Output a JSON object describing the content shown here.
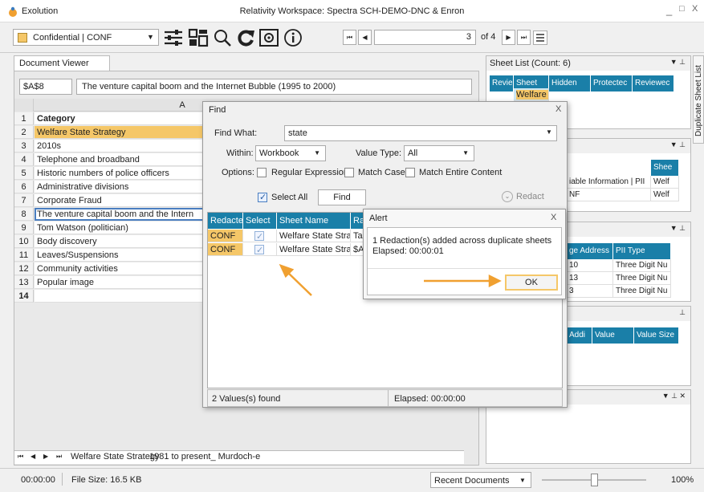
{
  "titlebar": {
    "app_name": "Exolution",
    "window_title": "Relativity Workspace: Spectra SCH-DEMO-DNC & Enron",
    "min": "_",
    "max": "□",
    "close": "X"
  },
  "toolbar": {
    "classification": "Confidential | CONF",
    "page_value": "3",
    "page_of": "of 4"
  },
  "doc_viewer": {
    "tab_label": "Document Viewer",
    "cell_ref": "$A$8",
    "formula": "The venture capital boom and the Internet Bubble (1995 to 2000)",
    "column_header": "A",
    "rows": [
      {
        "num": "1",
        "text": "Category"
      },
      {
        "num": "2",
        "text": "Welfare State Strategy"
      },
      {
        "num": "3",
        "text": "2010s"
      },
      {
        "num": "4",
        "text": "Telephone and broadband"
      },
      {
        "num": "5",
        "text": "Historic numbers of police officers"
      },
      {
        "num": "6",
        "text": "Administrative divisions"
      },
      {
        "num": "7",
        "text": "Corporate Fraud"
      },
      {
        "num": "8",
        "text": "The venture capital boom and the Intern"
      },
      {
        "num": "9",
        "text": "Tom Watson (politician)"
      },
      {
        "num": "10",
        "text": "Body discovery"
      },
      {
        "num": "11",
        "text": "Leaves/Suspensions"
      },
      {
        "num": "12",
        "text": "Community activities"
      },
      {
        "num": "13",
        "text": "Popular image"
      },
      {
        "num": "14",
        "text": ""
      }
    ],
    "sheet_tab_1": "Welfare State Strategy",
    "sheet_tab_2": "1981 to present_ Murdoch-e"
  },
  "find_dialog": {
    "title": "Find",
    "close": "X",
    "find_what_label": "Find What:",
    "find_what_value": "state",
    "within_label": "Within:",
    "within_value": "Workbook",
    "value_type_label": "Value Type:",
    "value_type_value": "All",
    "options_label": "Options:",
    "opt_regex": "Regular Expression",
    "opt_case": "Match Case",
    "opt_entire": "Match Entire Content",
    "select_all": "Select All",
    "find_button": "Find",
    "redact_button": "Redact",
    "columns": [
      "Redacte",
      "Select",
      "Sheet Name",
      "Ra"
    ],
    "results": [
      {
        "redaction": "CONF",
        "sheet": "Welfare State Stra",
        "range": "Tal"
      },
      {
        "redaction": "CONF",
        "sheet": "Welfare State Stra",
        "range": "$A"
      }
    ],
    "values_found": "2 Values(s) found",
    "elapsed": "Elapsed: 00:00:00"
  },
  "alert": {
    "title": "Alert",
    "close": "X",
    "message": "1 Redaction(s) added across duplicate sheets",
    "elapsed": "Elapsed: 00:00:01",
    "ok": "OK"
  },
  "sheet_list": {
    "title": "Sheet List (Count: 6)",
    "columns": [
      "Revie",
      "Sheet",
      "Hidden",
      "Protectec",
      "Reviewec"
    ],
    "first_sheet": "Welfare S"
  },
  "panel2": {
    "title_fragment": "3)",
    "col": "Shee",
    "row1": "iable Information | PII",
    "row1b": "Welf",
    "row2": "NF",
    "row2b": "Welf"
  },
  "panel3": {
    "columns": [
      "ge Address",
      "PII Type"
    ],
    "rows": [
      {
        "addr": "10",
        "type": "Three Digit Nu"
      },
      {
        "addr": "13",
        "type": "Three Digit Nu"
      },
      {
        "addr": "3",
        "type": "Three Digit Nu"
      }
    ]
  },
  "panel4": {
    "columns": [
      "Addi",
      "Value",
      "Value Size"
    ]
  },
  "duplicate_tab": "Duplicate Sheet List",
  "status": {
    "time": "00:00:00",
    "file_size": "File Size: 16.5 KB",
    "recent": "Recent Documents",
    "zoom": "100%"
  },
  "colors": {
    "accent": "#1a7fa8",
    "highlight": "#f5c768",
    "arrow": "#f0a030"
  }
}
